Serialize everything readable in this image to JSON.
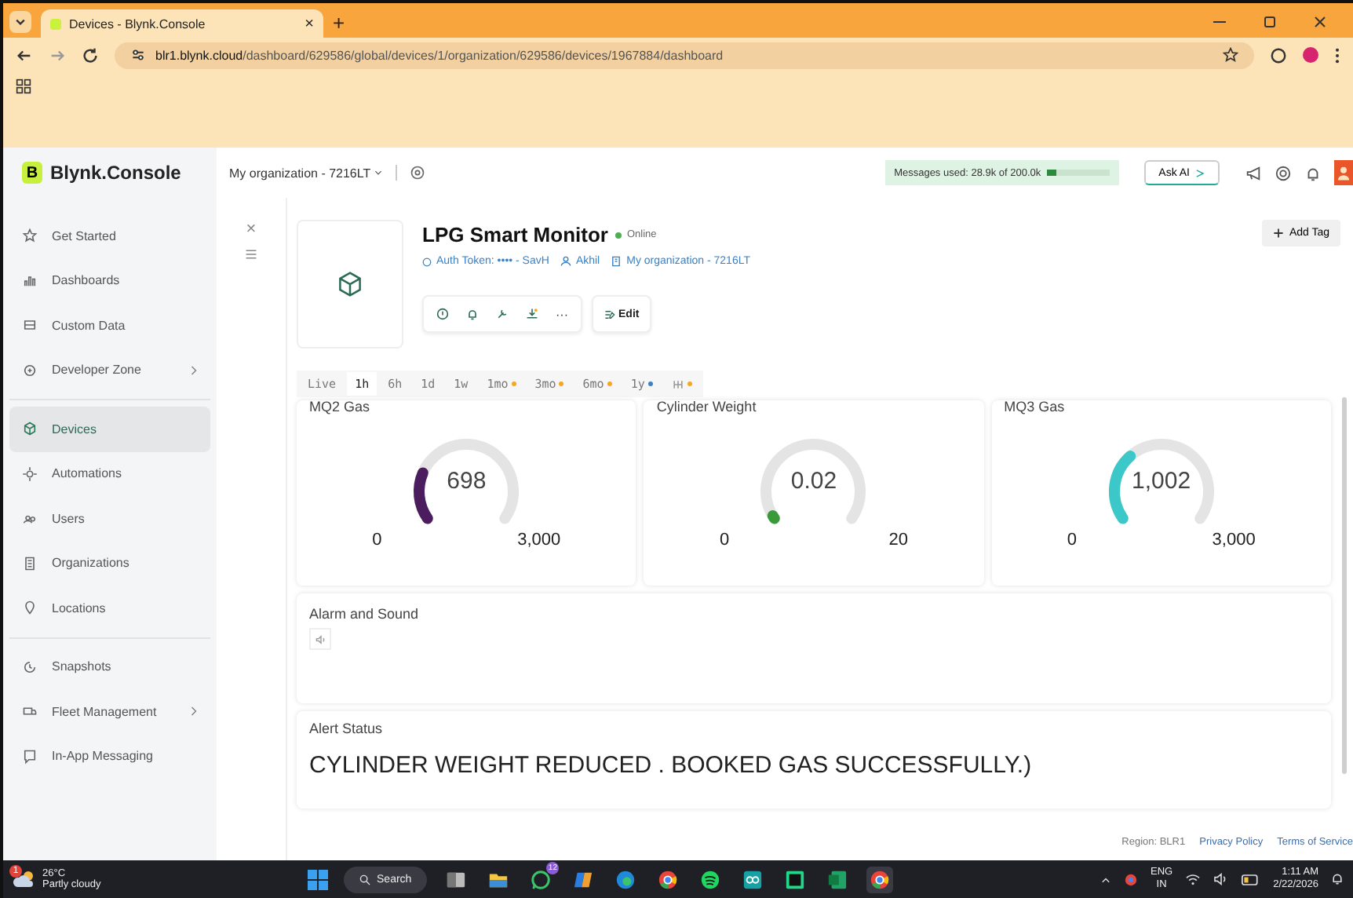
{
  "browser": {
    "tab_title": "Devices - Blynk.Console",
    "tab_close": "×",
    "new_tab": "+",
    "url_host": "blr1.blynk.cloud",
    "url_path": "/dashboard/629586/global/devices/1/organization/629586/devices/1967884/dashboard"
  },
  "header": {
    "brand_letter": "B",
    "brand": "Blynk.Console",
    "org": "My organization - 7216LT",
    "messages": {
      "label": "Messages used: 28.9k of 200.0k",
      "level": 0.1445
    },
    "ask_ai": "Ask AI"
  },
  "sidebar": {
    "sections": [
      {
        "items": [
          {
            "label": "Get Started",
            "selected": false,
            "submenu": false
          },
          {
            "label": "Dashboards",
            "selected": false,
            "submenu": false
          },
          {
            "label": "Custom Data",
            "selected": false,
            "submenu": false
          },
          {
            "label": "Developer Zone",
            "selected": false,
            "submenu": true
          }
        ]
      },
      {
        "items": [
          {
            "label": "Devices",
            "selected": true,
            "submenu": false
          },
          {
            "label": "Automations",
            "selected": false,
            "submenu": false
          },
          {
            "label": "Users",
            "selected": false,
            "submenu": false
          },
          {
            "label": "Organizations",
            "selected": false,
            "submenu": false
          },
          {
            "label": "Locations",
            "selected": false,
            "submenu": false
          }
        ]
      },
      {
        "items": [
          {
            "label": "Snapshots",
            "selected": false,
            "submenu": false
          },
          {
            "label": "Fleet Management",
            "selected": false,
            "submenu": true
          },
          {
            "label": "In-App Messaging",
            "selected": false,
            "submenu": false
          }
        ]
      }
    ]
  },
  "panel_close": "×",
  "device": {
    "name": "LPG Smart Monitor",
    "status": "Online",
    "online": true,
    "auth_label": "Auth Token:",
    "token": "•••• - SavH",
    "owner": "Akhil",
    "org": "My organization - 7216LT",
    "edit": "Edit",
    "add_tag": "Add Tag",
    "more": "···"
  },
  "time_ranges": [
    {
      "kind": "text",
      "label": "Live",
      "selected": false
    },
    {
      "kind": "text",
      "label": "1h",
      "selected": true
    },
    {
      "kind": "text",
      "label": "6h",
      "selected": false
    },
    {
      "kind": "text",
      "label": "1d",
      "selected": false
    },
    {
      "kind": "text",
      "label": "1w",
      "selected": false
    },
    {
      "kind": "text",
      "label": "1mo",
      "selected": false,
      "color": "#f5a623"
    },
    {
      "kind": "text",
      "label": "3mo",
      "selected": false,
      "color": "#f5a623"
    },
    {
      "kind": "text",
      "label": "6mo",
      "selected": false,
      "color": "#f5a623"
    },
    {
      "kind": "text",
      "label": "1y",
      "selected": false,
      "color": "#3b82c4"
    },
    {
      "kind": "custom",
      "selected": false,
      "color": "#f5a623"
    }
  ],
  "gauges": [
    {
      "title": "MQ2 Gas",
      "value": "698",
      "min": "0",
      "max": "3,000",
      "color": "#4b1d5e"
    },
    {
      "title": "Cylinder Weight",
      "value": "0.02",
      "min": "0",
      "max": "20",
      "color": "#3a9a3a"
    },
    {
      "title": "MQ3 Gas",
      "value": "1,002",
      "min": "0",
      "max": "3,000",
      "color": "#3cc8c8"
    }
  ],
  "alarm": {
    "title": "Alarm and Sound"
  },
  "alert": {
    "title": "Alert Status",
    "message": "CYLINDER WEIGHT REDUCED . BOOKED GAS SUCCESSFULLY.)"
  },
  "footer": {
    "region": "Region: BLR1",
    "links": [
      "Privacy Policy",
      "Terms of Service"
    ]
  },
  "taskbar": {
    "weather": {
      "temp": "26°C",
      "condition": "Partly cloudy",
      "badge": "1"
    },
    "search": "Search",
    "apps": [
      {
        "kind": "taskview",
        "active": false
      },
      {
        "kind": "folder",
        "active": false
      },
      {
        "kind": "chat",
        "active": false,
        "badge": "12"
      },
      {
        "kind": "copilot",
        "active": false
      },
      {
        "kind": "edge",
        "active": false
      },
      {
        "kind": "chrome",
        "active": false
      },
      {
        "kind": "music",
        "active": false
      },
      {
        "kind": "arduino",
        "active": false
      },
      {
        "kind": "ide",
        "active": false
      },
      {
        "kind": "sheet",
        "active": false
      },
      {
        "kind": "chrome",
        "active": true
      }
    ],
    "tray": {
      "lang": "ENG",
      "region": "IN",
      "time": "1:11 AM",
      "date": "2/22/2026"
    }
  }
}
